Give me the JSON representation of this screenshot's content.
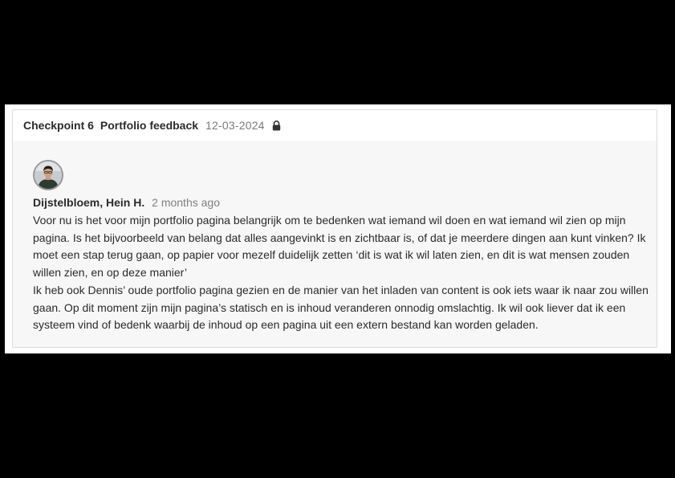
{
  "header": {
    "checkpoint": "Checkpoint 6",
    "title": "Portfolio feedback",
    "date": "12-03-2024",
    "lock_icon": "lock-icon"
  },
  "comment": {
    "author": "Dijstelbloem, Hein H.",
    "time_ago": "2 months ago",
    "avatar_icon": "avatar",
    "paragraphs": [
      "Voor nu is het voor mijn portfolio pagina belangrijk om te bedenken wat iemand wil doen en wat iemand wil zien op mijn pagina. Is het bijvoorbeeld van belang dat alles aangevinkt is en zichtbaar is, of dat je meerdere dingen aan kunt vinken? Ik moet een stap terug gaan, op papier voor mezelf duidelijk zetten ‘dit is wat ik wil laten zien, en dit is wat mensen zouden willen zien, en op deze manier’",
      "Ik heb ook Dennis’ oude portfolio pagina gezien en de manier van het inladen van content is ook iets waar ik naar zou willen gaan. Op dit moment zijn mijn pagina’s statisch en is inhoud veranderen onnodig omslachtig. Ik wil ook liever dat ik een systeem vind of bedenk waarbij de inhoud op een pagina uit een extern bestand kan worden geladen."
    ]
  },
  "colors": {
    "background": "#000000",
    "card": "#f7f7f7",
    "header": "#ffffff",
    "text": "#2b2b2b",
    "muted": "#7a7a7a"
  }
}
